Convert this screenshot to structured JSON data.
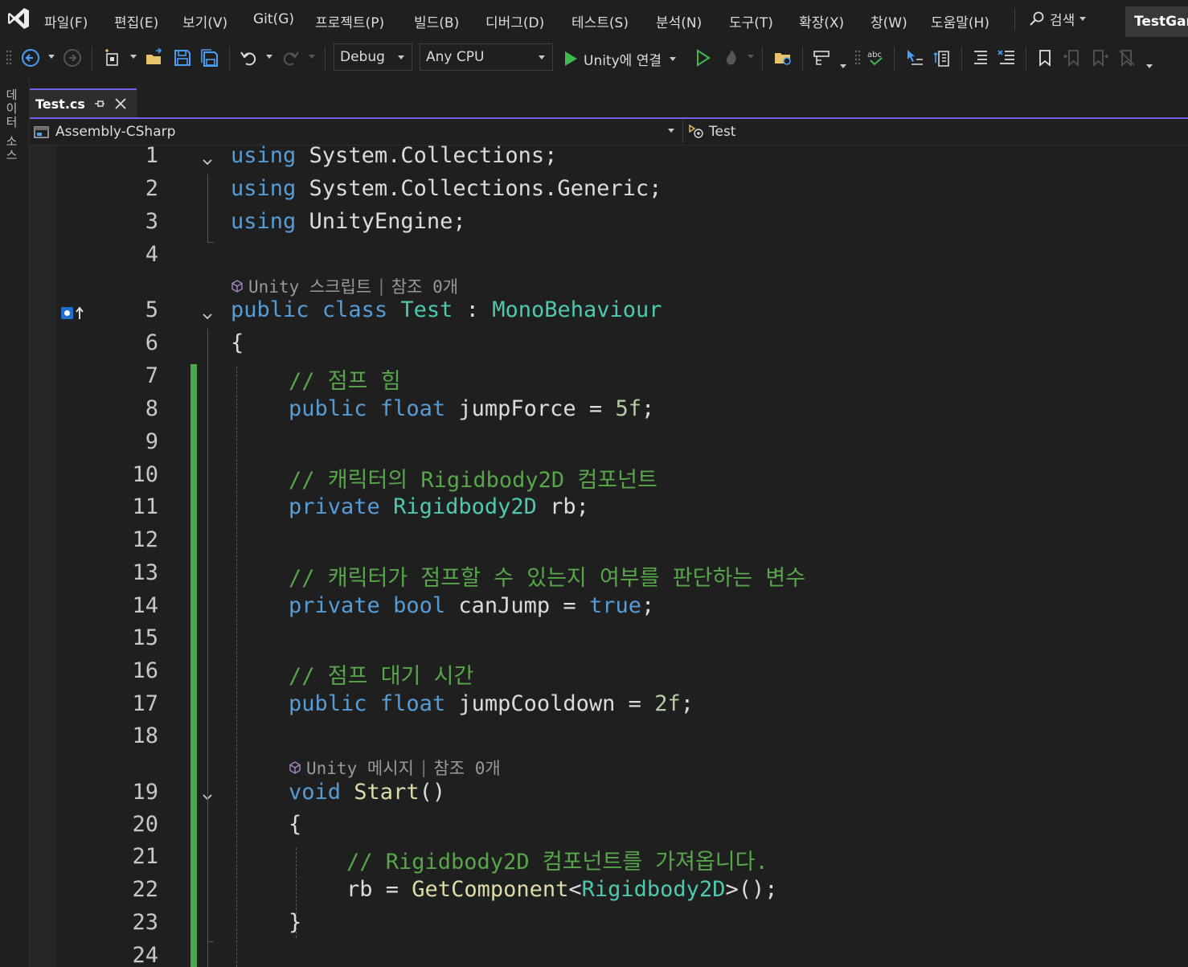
{
  "menubar": {
    "items": [
      "파일(F)",
      "편집(E)",
      "보기(V)",
      "Git(G)",
      "프로젝트(P)",
      "빌드(B)",
      "디버그(D)",
      "테스트(S)",
      "분석(N)",
      "도구(T)",
      "확장(X)",
      "창(W)",
      "도움말(H)"
    ],
    "search_label": "검색",
    "solution_name": "TestGan"
  },
  "toolbar": {
    "configuration": "Debug",
    "platform": "Any CPU",
    "run_label": "Unity에 연결"
  },
  "left_strip": {
    "label": "데이터 소스"
  },
  "tabs": [
    {
      "title": "Test.cs"
    }
  ],
  "navbar": {
    "project": "Assembly-CSharp",
    "type": "Test"
  },
  "colors": {
    "accent": "#7160e8",
    "keyword": "#569cd6",
    "type": "#4ec9b0",
    "comment": "#57a64a",
    "method": "#dcdcaa",
    "number": "#b5cea8",
    "change_bar": "#4ba94b"
  },
  "editor": {
    "codelens": [
      {
        "unity": "Unity 스크립트",
        "refs": "참조 0개"
      },
      {
        "unity": "Unity 메시지",
        "refs": "참조 0개"
      }
    ],
    "lines": [
      {
        "num": "1",
        "tokens": [
          [
            "kw",
            "using"
          ],
          [
            "",
            "System.Collections;"
          ]
        ]
      },
      {
        "num": "2",
        "tokens": [
          [
            "kw",
            "using"
          ],
          [
            "",
            "System.Collections.Generic;"
          ]
        ]
      },
      {
        "num": "3",
        "tokens": [
          [
            "kw",
            "using"
          ],
          [
            "",
            "UnityEngine;"
          ]
        ]
      },
      {
        "num": "4",
        "tokens": []
      },
      {
        "num": "5",
        "tokens": [
          [
            "kw",
            "public"
          ],
          [
            "kw",
            "class"
          ],
          [
            "ty",
            "Test"
          ],
          [
            "",
            ":"
          ],
          [
            "ty",
            "MonoBehaviour"
          ]
        ]
      },
      {
        "num": "6",
        "tokens": [
          [
            "",
            "{"
          ]
        ]
      },
      {
        "num": "7",
        "tokens": [
          [
            "cm",
            "// 점프 힘"
          ]
        ]
      },
      {
        "num": "8",
        "tokens": [
          [
            "kw",
            "public"
          ],
          [
            "kw",
            "float"
          ],
          [
            "",
            "jumpForce ="
          ],
          [
            "nm",
            "5f"
          ],
          [
            "",
            ";"
          ]
        ]
      },
      {
        "num": "9",
        "tokens": []
      },
      {
        "num": "10",
        "tokens": [
          [
            "cm",
            "// 캐릭터의 Rigidbody2D 컴포넌트"
          ]
        ]
      },
      {
        "num": "11",
        "tokens": [
          [
            "kw",
            "private"
          ],
          [
            "ty",
            "Rigidbody2D"
          ],
          [
            "",
            "rb;"
          ]
        ]
      },
      {
        "num": "12",
        "tokens": []
      },
      {
        "num": "13",
        "tokens": [
          [
            "cm",
            "// 캐릭터가 점프할 수 있는지 여부를 판단하는 변수"
          ]
        ]
      },
      {
        "num": "14",
        "tokens": [
          [
            "kw",
            "private"
          ],
          [
            "kw",
            "bool"
          ],
          [
            "",
            "canJump ="
          ],
          [
            "kw",
            "true"
          ],
          [
            "",
            ";"
          ]
        ]
      },
      {
        "num": "15",
        "tokens": []
      },
      {
        "num": "16",
        "tokens": [
          [
            "cm",
            "// 점프 대기 시간"
          ]
        ]
      },
      {
        "num": "17",
        "tokens": [
          [
            "kw",
            "public"
          ],
          [
            "kw",
            "float"
          ],
          [
            "",
            "jumpCooldown ="
          ],
          [
            "nm",
            "2f"
          ],
          [
            "",
            ";"
          ]
        ]
      },
      {
        "num": "18",
        "tokens": []
      },
      {
        "num": "19",
        "tokens": [
          [
            "kw",
            "void"
          ],
          [
            "mt",
            "Start"
          ],
          [
            "",
            "()"
          ]
        ]
      },
      {
        "num": "20",
        "tokens": [
          [
            "",
            "{"
          ]
        ]
      },
      {
        "num": "21",
        "tokens": [
          [
            "cm",
            "// Rigidbody2D 컴포넌트를 가져옵니다."
          ]
        ]
      },
      {
        "num": "22",
        "tokens": [
          [
            "",
            "rb ="
          ],
          [
            "mt",
            "GetComponent"
          ],
          [
            "",
            "<"
          ],
          [
            "ty",
            "Rigidbody2D"
          ],
          [
            "",
            ">();"
          ]
        ]
      },
      {
        "num": "23",
        "tokens": [
          [
            "",
            "}"
          ]
        ]
      },
      {
        "num": "24",
        "tokens": []
      }
    ]
  }
}
